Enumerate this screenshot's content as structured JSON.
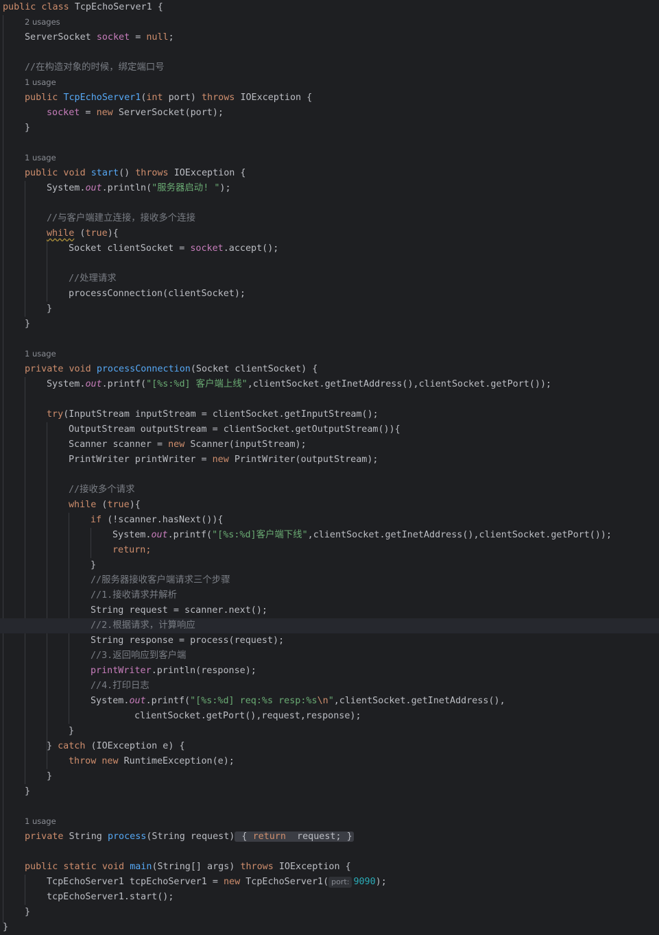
{
  "editor": {
    "language": "Java",
    "class_name": "TcpEchoServer1",
    "usages": {
      "socket_field": "2 usages",
      "constructor": "1 usage",
      "start": "1 usage",
      "process_connection": "1 usage",
      "process": "1 usage"
    },
    "comments": {
      "bind_port": "//在构造对象的时候，绑定端口号",
      "accept_clients": "//与客户端建立连接，接收多个连接",
      "handle_request": "//处理请求",
      "receive_requests": "//接收多个请求",
      "three_steps": "//服务器接收客户端请求三个步骤",
      "step1": "//1.接收请求并解析",
      "step2": "//2.根据请求，计算响应",
      "step3": "//3.返回响应到客户端",
      "step4": "//4.打印日志"
    },
    "strings": {
      "server_started": "\"服务器启动! \"",
      "client_online": "\"[%s:%d] 客户端上线\"",
      "client_offline": "\"[%s:%d]客户端下线\"",
      "log_format_pre": "\"[%s:%d] req:%s resp:%s",
      "log_format_escape": "\\n",
      "log_format_post": "\""
    },
    "param_hint": "port:",
    "port_number": "9090",
    "code": {
      "l0": "public class TcpEchoServer1 {",
      "l2": "ServerSocket socket = null;",
      "l6": "public TcpEchoServer1(int port) throws IOException {",
      "l7": "socket = new ServerSocket(port);",
      "l11": "public void start() throws IOException {",
      "l14": "while (true){",
      "l15": "Socket clientSocket = socket.accept();",
      "l17": "processConnection(clientSocket);",
      "l21": "private void processConnection(Socket clientSocket) {",
      "l24": "try(InputStream inputStream = clientSocket.getInputStream();",
      "l25": "OutputStream outputStream = clientSocket.getOutputStream()){",
      "l26": "Scanner scanner = new Scanner(inputStream);",
      "l27": "PrintWriter printWriter = new PrintWriter(outputStream);",
      "l29": "while (true){",
      "l30": "if (!scanner.hasNext()){",
      "l32": "return;",
      "l35": "String request = scanner.next();",
      "l37": "String response = process(request);",
      "l39": "printWriter.println(response);",
      "l42": "clientSocket.getPort(),request,response);",
      "l44": "} catch (IOException e) {",
      "l45": "throw new RuntimeException(e);",
      "l49": "private String process(String request) { return  request; }",
      "l51": "public static void main(String[] args) throws IOException {",
      "l52": "TcpEchoServer1 tcpEchoServer1 = new TcpEchoServer1(9090);",
      "l53": "tcpEchoServer1.start();",
      "print_args_online": ",clientSocket.getInetAddress(),clientSocket.getPort());",
      "log_args_first": ",clientSocket.getInetAddress(),"
    }
  }
}
